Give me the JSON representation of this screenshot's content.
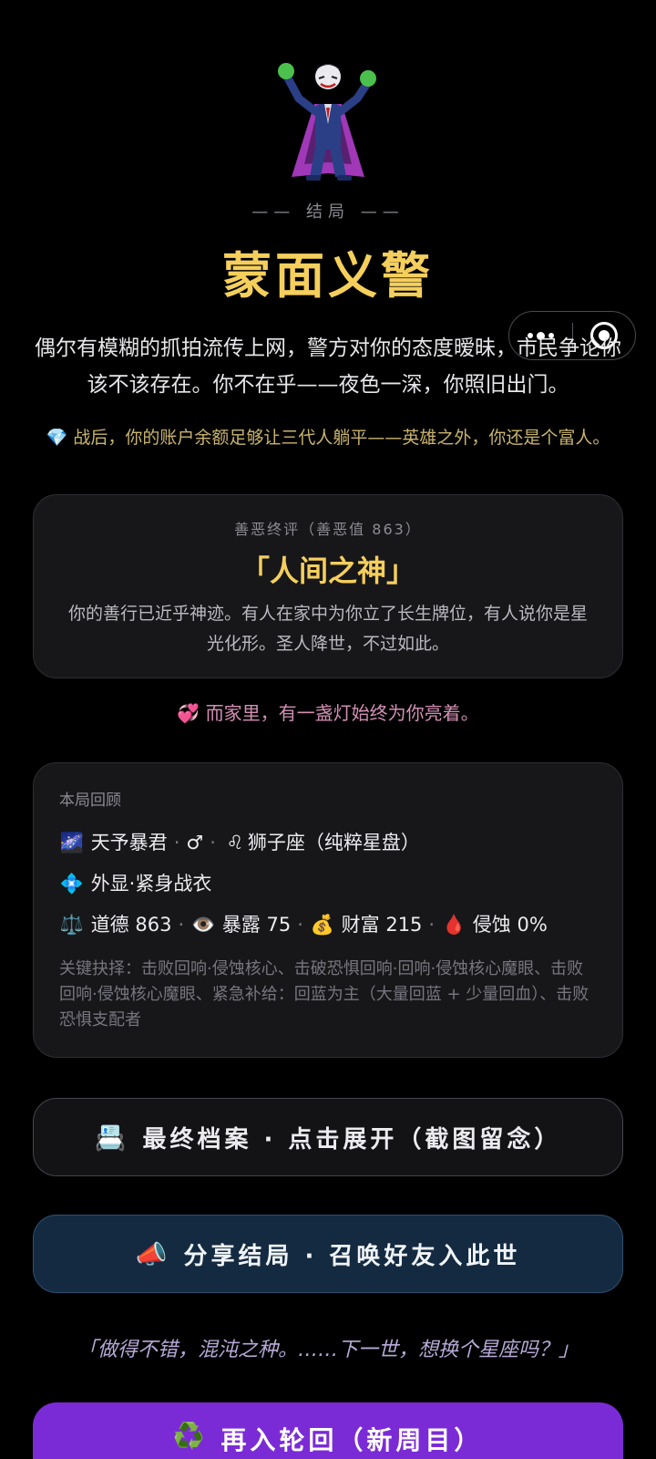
{
  "ending": {
    "subtitle": "—— 结局 ——",
    "title": "蒙面义警",
    "story": "偶尔有模糊的抓拍流传上网，警方对你的态度暧昧，市民争论你该不该存在。你不在乎——夜色一深，你照旧出门。",
    "wealth_note": "战后，你的账户余额足够让三代人躺平——英雄之外，你还是个富人。",
    "icon": "villain-figure"
  },
  "verdict": {
    "label": "善恶终评（善恶值 863）",
    "title": "「人间之神」",
    "description": "你的善行已近乎神迹。有人在家中为你立了长生牌位，有人说你是星光化形。圣人降世，不过如此。"
  },
  "family_note": "而家里，有一盏灯始终为你亮着。",
  "review": {
    "label": "本局回顾",
    "talent": "天予暴君",
    "gender": "♂",
    "zodiac": "狮子座（纯粹星盘）",
    "appearance": "外显·紧身战衣",
    "stats": {
      "morality_label": "道德",
      "morality": "863",
      "exposure_label": "暴露",
      "exposure": "75",
      "wealth_label": "财富",
      "wealth": "215",
      "erosion_label": "侵蚀",
      "erosion": "0%"
    },
    "choices": "关键抉择：击败回响·侵蚀核心、击破恐惧回响·回响·侵蚀核心魔眼、击败回响·侵蚀核心魔眼、紧急补给：回蓝为主（大量回蓝 + 少量回血）、击败恐惧支配者"
  },
  "buttons": {
    "archive": "最终档案 · 点击展开（截图留念）",
    "share": "分享结局 · 召唤好友入此世",
    "rebirth": "再入轮回（新周目）"
  },
  "quote": "「做得不错，混沌之种。……下一世，想换个星座吗？」",
  "colors": {
    "gold": "#f5cf5c",
    "rebirth": "#7b2bd6",
    "share_bg": "#142a41"
  }
}
